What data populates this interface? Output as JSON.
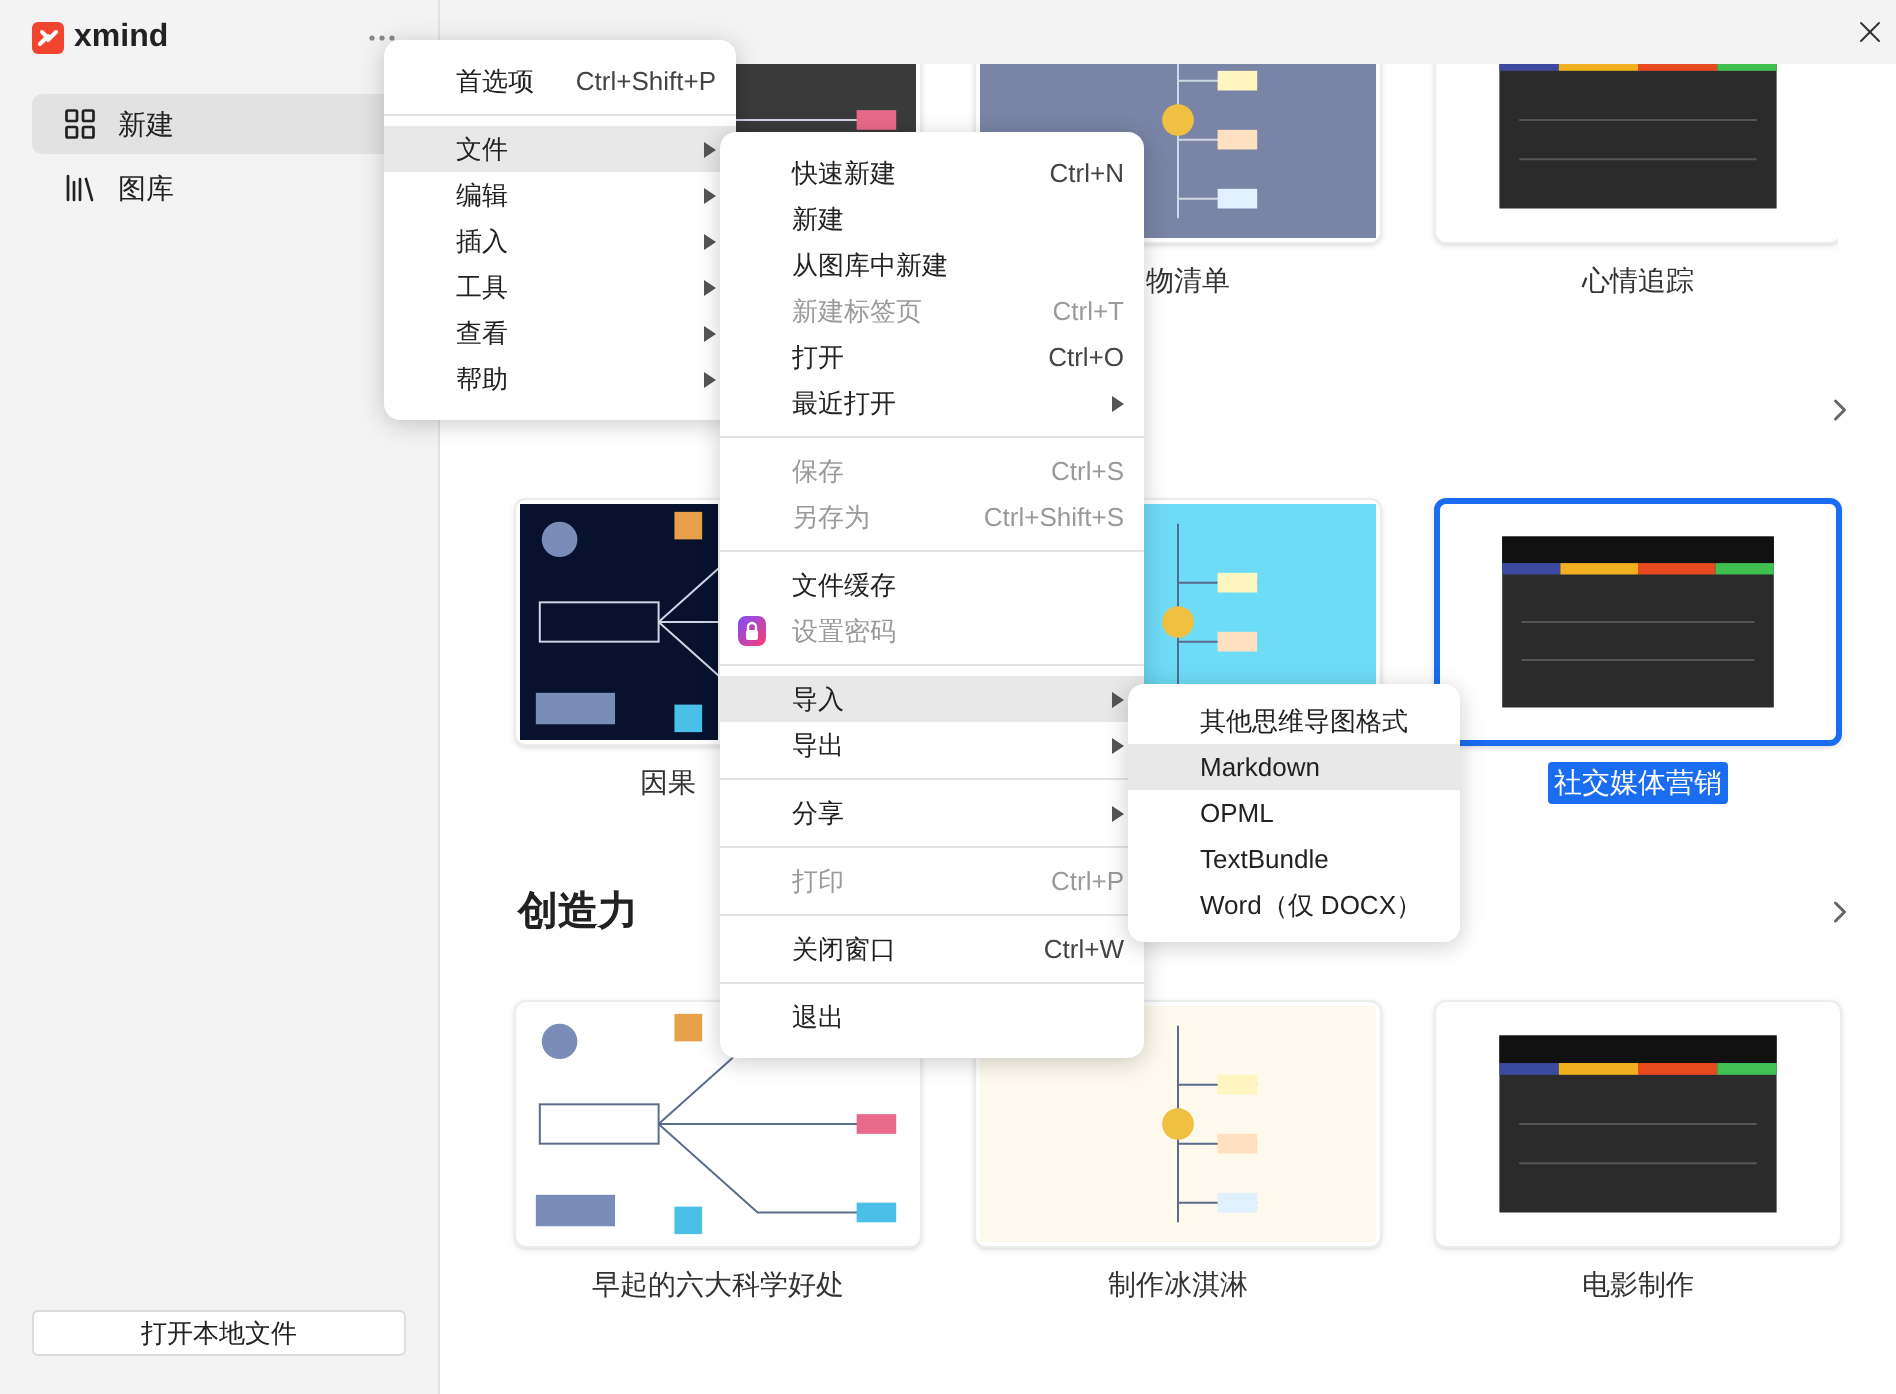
{
  "app": {
    "logo_text": "xmind"
  },
  "sidebar": {
    "items": [
      {
        "label": "新建",
        "selected": true
      },
      {
        "label": "图库",
        "selected": false
      }
    ],
    "open_button": "打开本地文件"
  },
  "sections": [
    {
      "cards": [
        {
          "kind": "picture",
          "selected": false
        },
        {
          "kind": "picture",
          "selected": false,
          "caption": "物清单"
        },
        {
          "kind": "picture",
          "selected": false,
          "caption": "心情追踪"
        }
      ]
    },
    {
      "cards": [
        {
          "kind": "picture",
          "selected": false,
          "caption": "因果"
        },
        {
          "kind": "picture",
          "selected": false
        },
        {
          "kind": "picture",
          "selected": true,
          "caption": "社交媒体营销"
        }
      ]
    },
    {
      "heading": "创造力",
      "cards": [
        {
          "kind": "picture",
          "selected": false,
          "caption": "早起的六大科学好处"
        },
        {
          "kind": "picture",
          "selected": false,
          "caption": "制作冰淇淋"
        },
        {
          "kind": "picture",
          "selected": false,
          "caption": "电影制作"
        }
      ]
    }
  ],
  "main_menu": [
    {
      "kind": "item",
      "label": "首选项",
      "shortcut": "Ctrl+Shift+P",
      "submenu": false,
      "selected": false
    },
    {
      "kind": "separator"
    },
    {
      "kind": "item",
      "label": "文件",
      "submenu": true,
      "selected": true
    },
    {
      "kind": "item",
      "label": "编辑",
      "submenu": true,
      "selected": false
    },
    {
      "kind": "item",
      "label": "插入",
      "submenu": true,
      "selected": false
    },
    {
      "kind": "item",
      "label": "工具",
      "submenu": true,
      "selected": false
    },
    {
      "kind": "item",
      "label": "查看",
      "submenu": true,
      "selected": false
    },
    {
      "kind": "item",
      "label": "帮助",
      "submenu": true,
      "selected": false
    }
  ],
  "file_menu": [
    {
      "kind": "item",
      "label": "快速新建",
      "shortcut": "Ctrl+N",
      "disabled": false,
      "submenu": false,
      "selected": false
    },
    {
      "kind": "item",
      "label": "新建",
      "disabled": false,
      "submenu": false,
      "selected": false
    },
    {
      "kind": "item",
      "label": "从图库中新建",
      "disabled": false,
      "submenu": false,
      "selected": false
    },
    {
      "kind": "item",
      "label": "新建标签页",
      "shortcut": "Ctrl+T",
      "disabled": true,
      "submenu": false,
      "selected": false
    },
    {
      "kind": "item",
      "label": "打开",
      "shortcut": "Ctrl+O",
      "disabled": false,
      "submenu": false,
      "selected": false
    },
    {
      "kind": "item",
      "label": "最近打开",
      "disabled": false,
      "submenu": true,
      "selected": false
    },
    {
      "kind": "separator"
    },
    {
      "kind": "item",
      "label": "保存",
      "shortcut": "Ctrl+S",
      "disabled": true,
      "submenu": false,
      "selected": false
    },
    {
      "kind": "item",
      "label": "另存为",
      "shortcut": "Ctrl+Shift+S",
      "disabled": true,
      "submenu": false,
      "selected": false
    },
    {
      "kind": "separator"
    },
    {
      "kind": "item",
      "label": "文件缓存",
      "disabled": false,
      "submenu": false,
      "selected": false
    },
    {
      "kind": "locked-item",
      "label": "设置密码",
      "disabled": true,
      "submenu": false,
      "selected": false
    },
    {
      "kind": "separator"
    },
    {
      "kind": "item",
      "label": "导入",
      "disabled": false,
      "submenu": true,
      "selected": true
    },
    {
      "kind": "item",
      "label": "导出",
      "disabled": false,
      "submenu": true,
      "selected": false
    },
    {
      "kind": "separator"
    },
    {
      "kind": "item",
      "label": "分享",
      "disabled": false,
      "submenu": true,
      "selected": false
    },
    {
      "kind": "separator"
    },
    {
      "kind": "item",
      "label": "打印",
      "shortcut": "Ctrl+P",
      "disabled": true,
      "submenu": false,
      "selected": false
    },
    {
      "kind": "separator"
    },
    {
      "kind": "item",
      "label": "关闭窗口",
      "shortcut": "Ctrl+W",
      "disabled": false,
      "submenu": false,
      "selected": false
    },
    {
      "kind": "separator"
    },
    {
      "kind": "item",
      "label": "退出",
      "disabled": false,
      "submenu": false,
      "selected": false
    }
  ],
  "import_menu": [
    {
      "label": "其他思维导图格式",
      "selected": false
    },
    {
      "label": "Markdown",
      "selected": true
    },
    {
      "label": "OPML",
      "selected": false
    },
    {
      "label": "TextBundle",
      "selected": false
    },
    {
      "label": "Word（仅 DOCX）",
      "selected": false
    }
  ]
}
